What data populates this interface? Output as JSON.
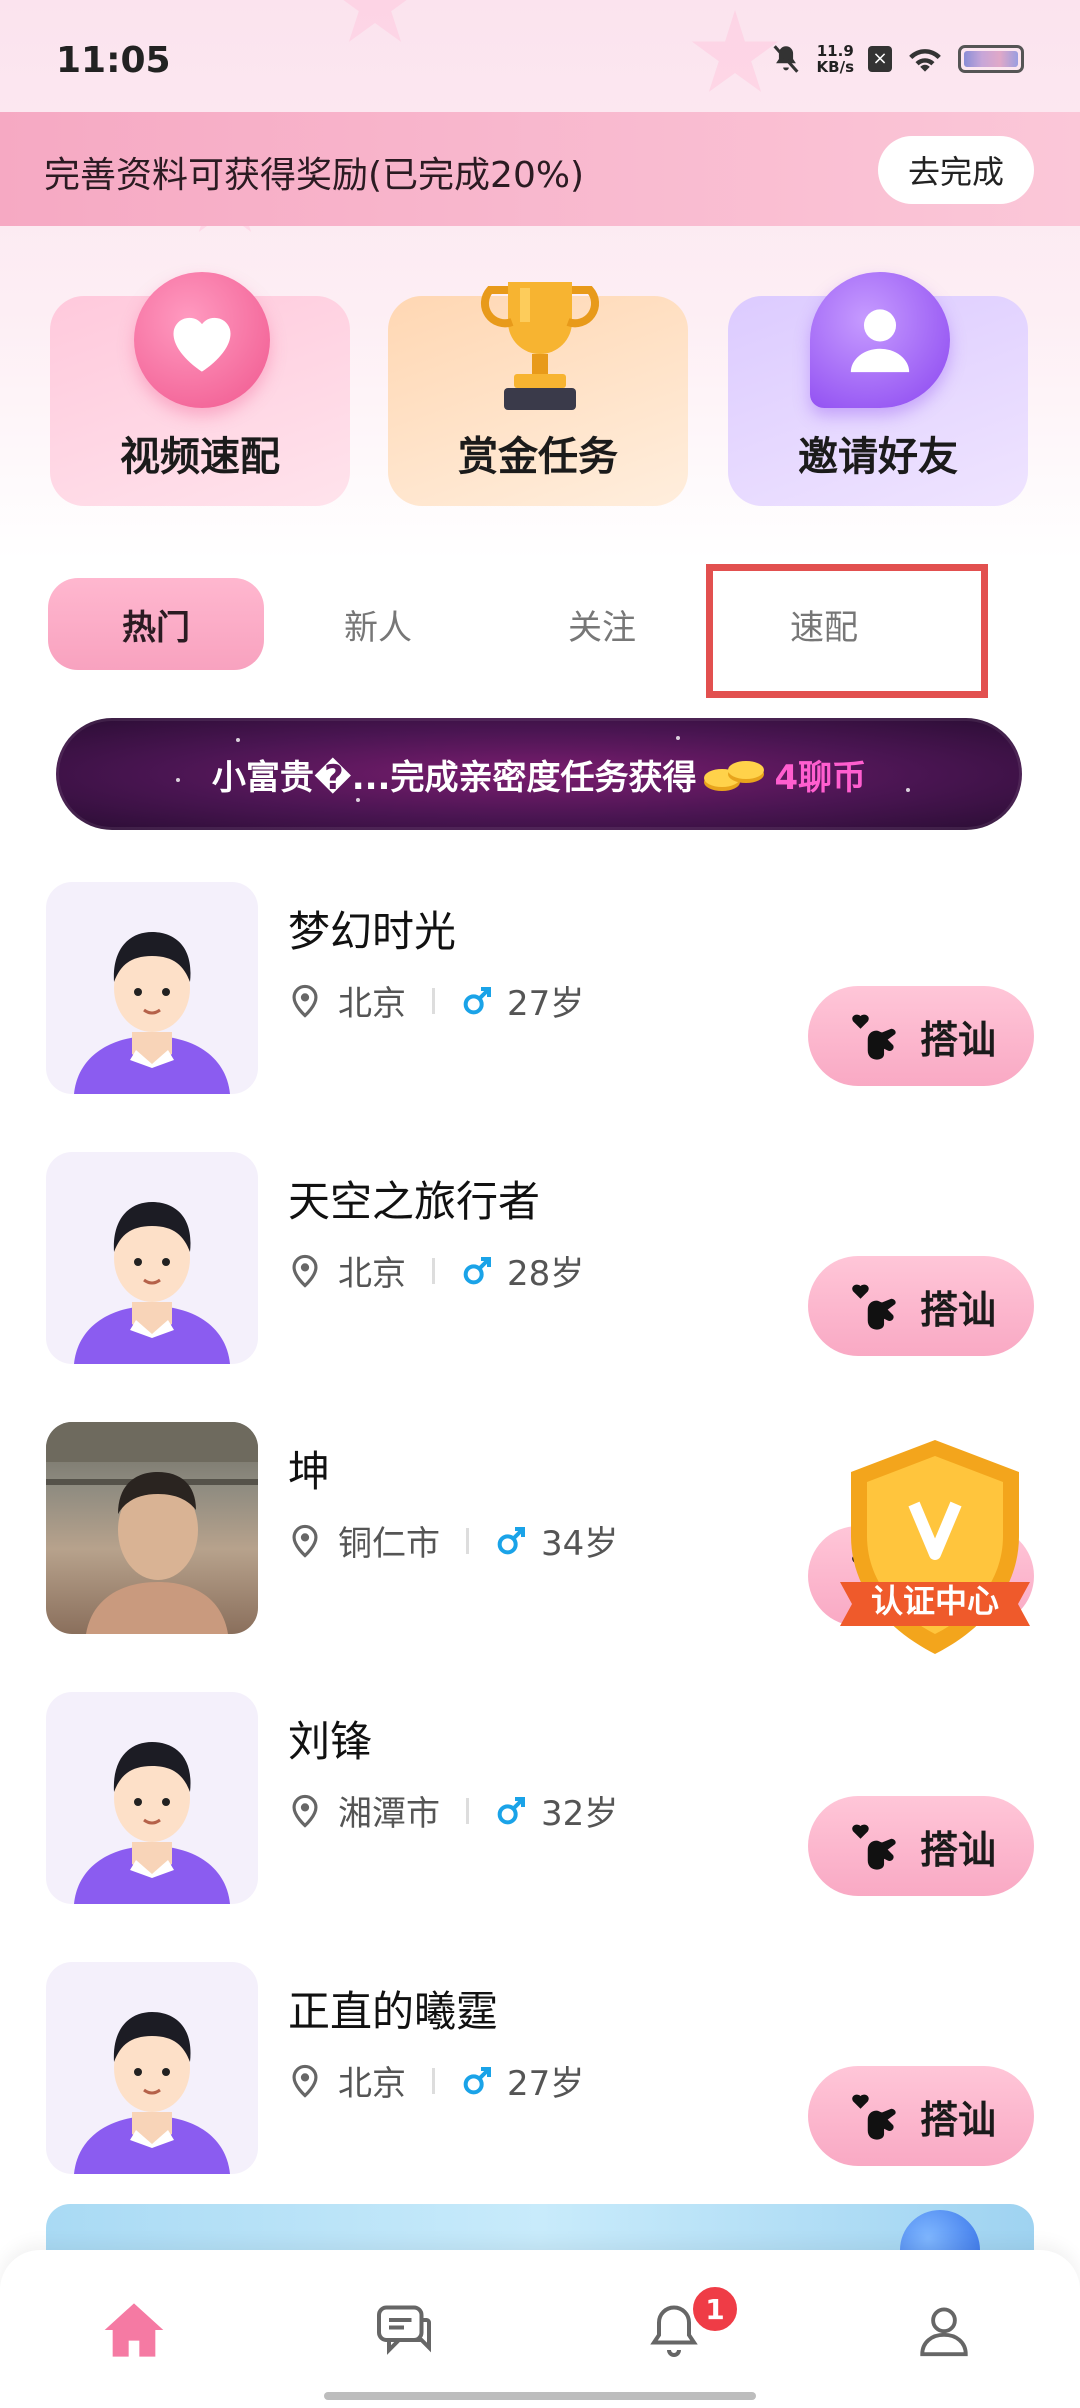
{
  "status_bar": {
    "time": "11:05",
    "net_speed_value": "11.9",
    "net_speed_unit": "KB/s"
  },
  "promo": {
    "text": "完善资料可获得奖励(已完成20%)",
    "button": "去完成"
  },
  "features": [
    {
      "label": "视频速配",
      "icon": "heart-icon"
    },
    {
      "label": "赏金任务",
      "icon": "trophy-icon"
    },
    {
      "label": "邀请好友",
      "icon": "person-chat-icon"
    }
  ],
  "tabs": [
    {
      "label": "热门",
      "active": true
    },
    {
      "label": "新人",
      "active": false
    },
    {
      "label": "关注",
      "active": false
    },
    {
      "label": "速配",
      "active": false
    }
  ],
  "gift_banner": {
    "text": "小富贵�...完成亲密度任务获得",
    "amount": "4聊币"
  },
  "users": [
    {
      "name": "梦幻时光",
      "city": "北京",
      "age": "27岁",
      "button": "搭讪"
    },
    {
      "name": "天空之旅行者",
      "city": "北京",
      "age": "28岁",
      "button": "搭讪"
    },
    {
      "name": "坤",
      "city": "铜仁市",
      "age": "34岁",
      "button": "搭讪"
    },
    {
      "name": "刘锋",
      "city": "湘潭市",
      "age": "32岁",
      "button": "搭讪"
    },
    {
      "name": "正直的曦霆",
      "city": "北京",
      "age": "27岁",
      "button": "搭讪"
    }
  ],
  "verify_badge": {
    "label": "认证中心"
  },
  "bottom_nav": {
    "items": [
      "home-icon",
      "messages-icon",
      "bell-icon",
      "profile-icon"
    ],
    "notification_count": "1"
  },
  "colors": {
    "accent_pink": "#f8a2bf",
    "active_home": "#f57aa3",
    "male_blue": "#1aa3e8",
    "badge_red": "#ef3c46"
  }
}
